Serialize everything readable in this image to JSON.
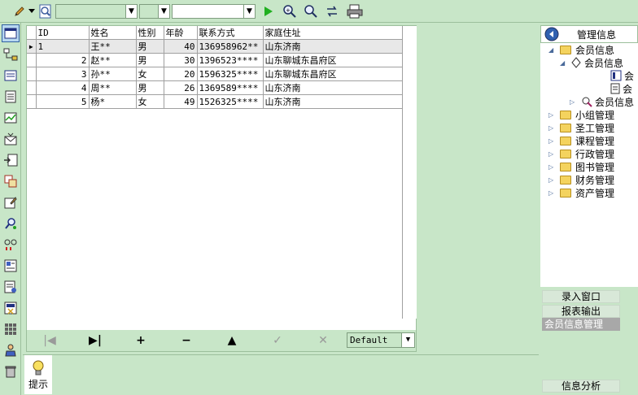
{
  "toolbar": {
    "icons": [
      "pencil-icon",
      "dropdown-arrow-icon",
      "search-page-icon",
      "play-icon",
      "find-icon",
      "find-next-icon",
      "refresh-icon",
      "print-icon"
    ],
    "combo1_value": "",
    "combo2_value": "",
    "combo3_value": ""
  },
  "leftbar": {
    "icons": [
      "window-icon",
      "network-icon",
      "form-icon",
      "document-icon",
      "chart-icon",
      "mail-icon",
      "export-icon",
      "grid-icon",
      "edit-icon",
      "search-users-icon",
      "link-icon",
      "report-icon",
      "doc-list-icon",
      "calc-icon",
      "apps-icon",
      "user-settings-icon",
      "trash-icon"
    ]
  },
  "grid": {
    "columns": [
      "ID",
      "姓名",
      "性别",
      "年龄",
      "联系方式",
      "家庭住址"
    ],
    "rows": [
      [
        "1",
        "王**",
        "男",
        "40",
        "136958962**",
        "山东济南"
      ],
      [
        "2",
        "赵**",
        "男",
        "30",
        "1396523****",
        "山东聊城东昌府区"
      ],
      [
        "3",
        "孙**",
        "女",
        "20",
        "1596325****",
        "山东聊城东昌府区"
      ],
      [
        "4",
        "周**",
        "男",
        "26",
        "1369589****",
        "山东济南"
      ],
      [
        "5",
        "杨*",
        "女",
        "49",
        "1526325****",
        "山东济南"
      ]
    ]
  },
  "navbar": {
    "buttons": [
      "|◀",
      "▶|",
      "+",
      "−",
      "▲",
      "✓",
      "✕"
    ],
    "filter_value": "Default"
  },
  "hint": {
    "label": "提示"
  },
  "right": {
    "title": "管理信息",
    "tree": {
      "member_info": "会员信息",
      "member_info_sub": "会员信息",
      "leaf1": "会",
      "leaf2": "会",
      "member_info_2": "会员信息",
      "groups": [
        "小组管理",
        "圣工管理",
        "课程管理",
        "行政管理",
        "图书管理",
        "财务管理",
        "资产管理"
      ]
    },
    "buttons": {
      "entry": "录入窗口",
      "report": "报表输出",
      "manage": "会员信息管理",
      "analysis": "信息分析"
    }
  }
}
